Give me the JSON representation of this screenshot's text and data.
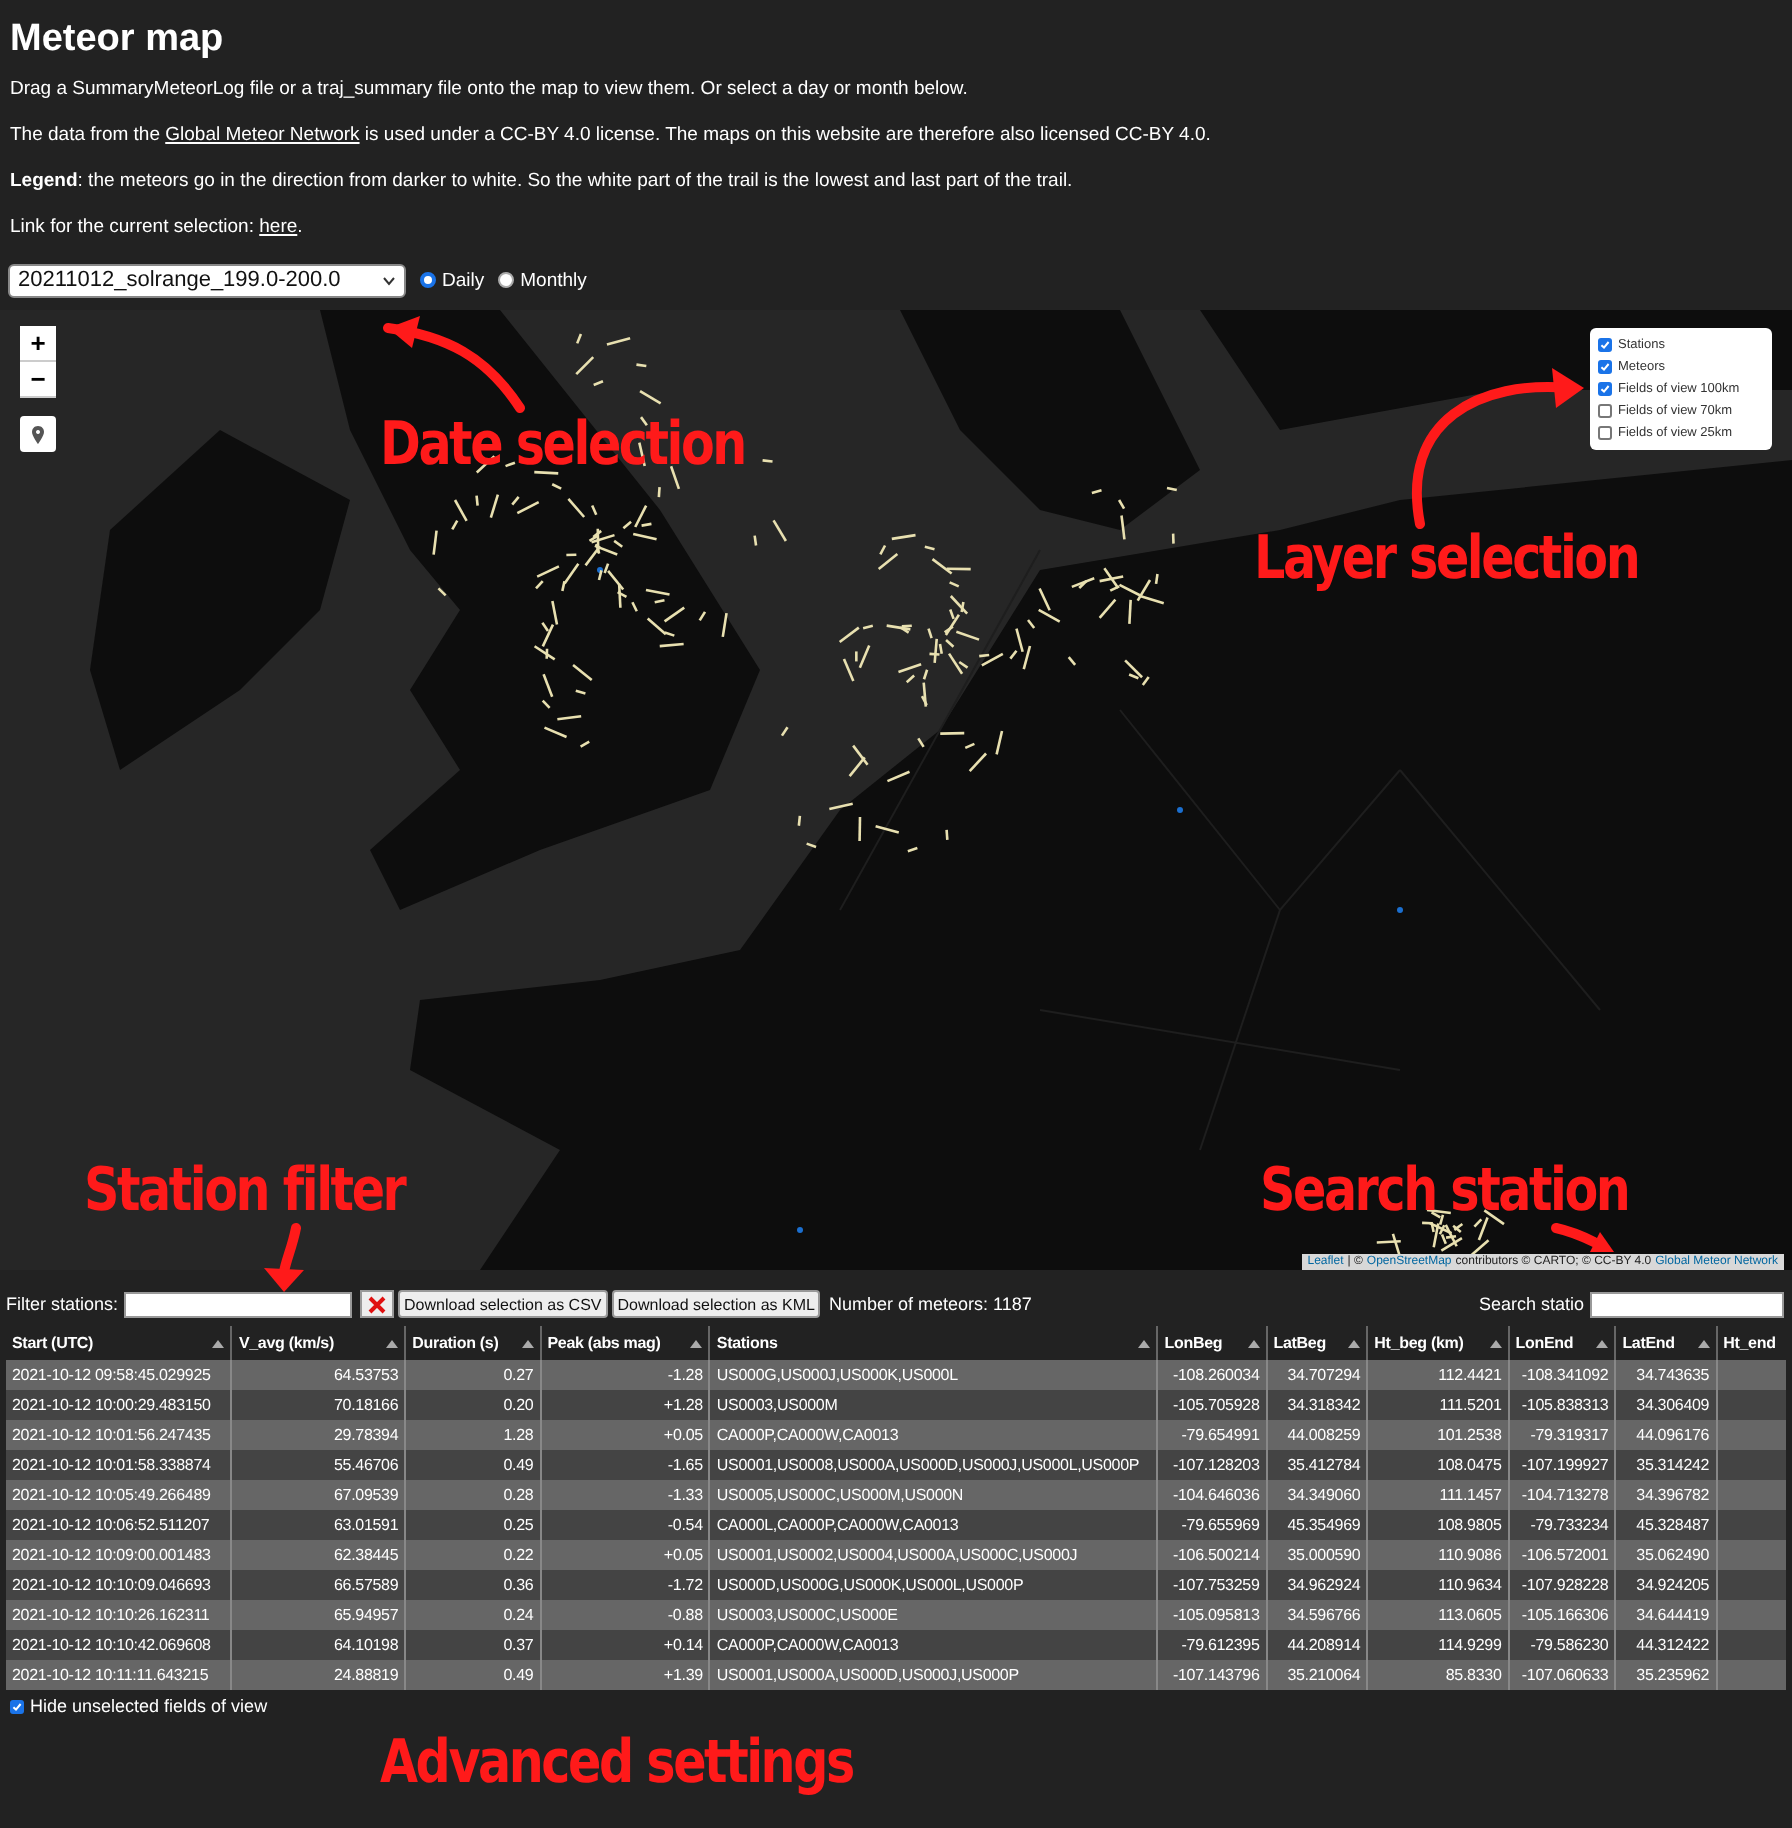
{
  "title": "Meteor map",
  "intro": "Drag a SummaryMeteorLog file or a traj_summary file onto the map to view them. Or select a day or month below.",
  "license": {
    "before": "The data from the ",
    "link": "Global Meteor Network",
    "after": " is used under a CC-BY 4.0 license. The maps on this website are therefore also licensed CC-BY 4.0."
  },
  "legend": "**Legend**: the meteors go in the direction from darker to white. So the white part of the trail is the lowest and last part of the trail.",
  "selection_link": {
    "before": "Link for the current selection: ",
    "link": "here",
    "after": "."
  },
  "date_select": {
    "value": "20211012_solrange_199.0-200.0"
  },
  "modes": [
    {
      "label": "Daily",
      "selected": true
    },
    {
      "label": "Monthly",
      "selected": false
    }
  ],
  "map": {
    "zoom_in": "+",
    "zoom_out": "−",
    "layers": [
      {
        "label": "Stations",
        "checked": true
      },
      {
        "label": "Meteors",
        "checked": true
      },
      {
        "label": "Fields of view 100km",
        "checked": true
      },
      {
        "label": "Fields of view 70km",
        "checked": false
      },
      {
        "label": "Fields of view 25km",
        "checked": false
      }
    ],
    "attribution": [
      {
        "text": "Leaflet",
        "kind": "link"
      },
      {
        "text": "| ©",
        "kind": "text"
      },
      {
        "text": "OpenStreetMap",
        "kind": "link"
      },
      {
        "text": "contributors © CARTO; © CC-BY 4.0",
        "kind": "text"
      },
      {
        "text": "Global Meteor Network",
        "kind": "link"
      }
    ]
  },
  "annotations": [
    {
      "text": "Date selection"
    },
    {
      "text": "Layer selection"
    },
    {
      "text": "Station filter"
    },
    {
      "text": "Search station"
    },
    {
      "text": "Advanced settings"
    }
  ],
  "toolbar": {
    "filter_label": "Filter stations:",
    "buttons": [
      "Download selection as CSV",
      "Download selection as KML"
    ],
    "count": "Number of meteors: 1187",
    "search_label": "Search statio"
  },
  "table": {
    "columns": [
      "Start (UTC)",
      "V_avg (km/s)",
      "Duration (s)",
      "Peak (abs mag)",
      "Stations",
      "LonBeg",
      "LatBeg",
      "Ht_beg (km)",
      "LonEnd",
      "LatEnd",
      "Ht_end"
    ],
    "rows": [
      [
        "2021-10-12 09:58:45.029925",
        "64.53753",
        "0.27",
        "-1.28",
        "US000G,US000J,US000K,US000L",
        "-108.260034",
        "34.707294",
        "112.4421",
        "-108.341092",
        "34.743635"
      ],
      [
        "2021-10-12 10:00:29.483150",
        "70.18166",
        "0.20",
        "+1.28",
        "US0003,US000M",
        "-105.705928",
        "34.318342",
        "111.5201",
        "-105.838313",
        "34.306409"
      ],
      [
        "2021-10-12 10:01:56.247435",
        "29.78394",
        "1.28",
        "+0.05",
        "CA000P,CA000W,CA0013",
        "-79.654991",
        "44.008259",
        "101.2538",
        "-79.319317",
        "44.096176"
      ],
      [
        "2021-10-12 10:01:58.338874",
        "55.46706",
        "0.49",
        "-1.65",
        "US0001,US0008,US000A,US000D,US000J,US000L,US000P",
        "-107.128203",
        "35.412784",
        "108.0475",
        "-107.199927",
        "35.314242"
      ],
      [
        "2021-10-12 10:05:49.266489",
        "67.09539",
        "0.28",
        "-1.33",
        "US0005,US000C,US000M,US000N",
        "-104.646036",
        "34.349060",
        "111.1457",
        "-104.713278",
        "34.396782"
      ],
      [
        "2021-10-12 10:06:52.511207",
        "63.01591",
        "0.25",
        "-0.54",
        "CA000L,CA000P,CA000W,CA0013",
        "-79.655969",
        "45.354969",
        "108.9805",
        "-79.733234",
        "45.328487"
      ],
      [
        "2021-10-12 10:09:00.001483",
        "62.38445",
        "0.22",
        "+0.05",
        "US0001,US0002,US0004,US000A,US000C,US000J",
        "-106.500214",
        "35.000590",
        "110.9086",
        "-106.572001",
        "35.062490"
      ],
      [
        "2021-10-12 10:10:09.046693",
        "66.57589",
        "0.36",
        "-1.72",
        "US000D,US000G,US000K,US000L,US000P",
        "-107.753259",
        "34.962924",
        "110.9634",
        "-107.928228",
        "34.924205"
      ],
      [
        "2021-10-12 10:10:26.162311",
        "65.94957",
        "0.24",
        "-0.88",
        "US0003,US000C,US000E",
        "-105.095813",
        "34.596766",
        "113.0605",
        "-105.166306",
        "34.644419"
      ],
      [
        "2021-10-12 10:10:42.069608",
        "64.10198",
        "0.37",
        "+0.14",
        "CA000P,CA000W,CA0013",
        "-79.612395",
        "44.208914",
        "114.9299",
        "-79.586230",
        "44.312422"
      ],
      [
        "2021-10-12 10:11:11.643215",
        "24.88819",
        "0.49",
        "+1.39",
        "US0001,US000A,US000D,US000J,US000P",
        "-107.143796",
        "35.210064",
        "85.8330",
        "-107.060633",
        "35.235962"
      ]
    ]
  },
  "hide_fov": {
    "label": "Hide unselected fields of view",
    "checked": true
  }
}
